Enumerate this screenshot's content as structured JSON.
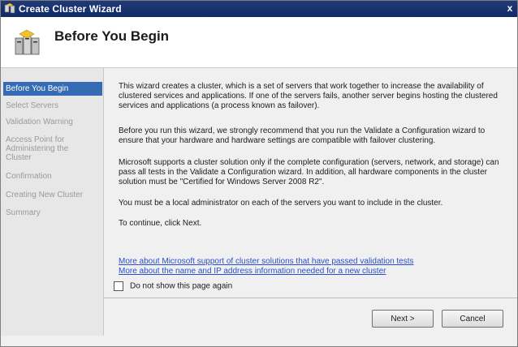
{
  "window": {
    "title": "Create Cluster Wizard",
    "close_glyph": "x"
  },
  "header": {
    "title": "Before You Begin"
  },
  "sidebar": {
    "items": [
      {
        "label": "Before You Begin",
        "active": true
      },
      {
        "label": "Select Servers"
      },
      {
        "label": "Validation Warning"
      },
      {
        "label": "Access Point for Administering the Cluster"
      },
      {
        "label": "Confirmation"
      },
      {
        "label": "Creating New Cluster"
      },
      {
        "label": "Summary"
      }
    ]
  },
  "content": {
    "p1": "This wizard creates a cluster, which is a set of servers that work together to increase the availability of clustered services and applications. If one of the servers fails, another server begins hosting the clustered services and applications (a process known as failover).",
    "p2": "Before you run this wizard, we strongly recommend that you run the Validate a Configuration wizard to ensure that your hardware and hardware settings are compatible with failover clustering.",
    "p3": "Microsoft supports a cluster solution only if the complete configuration (servers, network, and storage) can pass all tests in the Validate a Configuration wizard.  In addition, all hardware components in the cluster solution must be \"Certified for Windows Server 2008 R2\".",
    "p4": "You must be a local administrator on each of the servers you want to include in the cluster.",
    "p5": "To continue, click Next.",
    "link1": "More about Microsoft support of cluster solutions that have passed validation tests",
    "link2": "More about the name and IP address information needed for a new cluster",
    "checkbox_label": "Do not show this page again",
    "checkbox_checked": false
  },
  "buttons": {
    "next": "Next >",
    "cancel": "Cancel"
  },
  "colors": {
    "titlebar": "#0f2a68",
    "active_item": "#356bb5",
    "link": "#2a4fcc"
  }
}
